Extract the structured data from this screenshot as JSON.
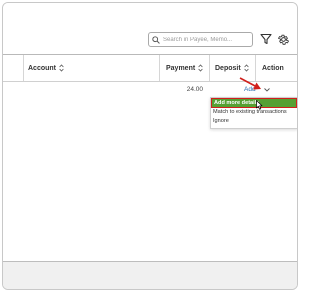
{
  "search": {
    "placeholder": "Search in Payee, Memo..."
  },
  "icons": {
    "search": "search-icon",
    "filter": "filter-icon",
    "settings": "gear-icon",
    "sort": "sort-icon",
    "chevron": "chevron-down-icon",
    "annotation_arrow": "red-arrow-icon",
    "cursor": "mouse-pointer-icon"
  },
  "table": {
    "columns": [
      {
        "label": "Account",
        "sortable": true
      },
      {
        "label": "Payment",
        "sortable": true
      },
      {
        "label": "Deposit",
        "sortable": true
      },
      {
        "label": "Action",
        "sortable": false
      }
    ],
    "rows": [
      {
        "payment": "24.00",
        "deposit": "",
        "action_label": "Add"
      }
    ]
  },
  "action_menu": {
    "items": [
      {
        "label": "Add more details",
        "highlighted": true
      },
      {
        "label": "Match to existing transactions",
        "highlighted": false
      },
      {
        "label": "Ignore",
        "highlighted": false
      }
    ]
  },
  "colors": {
    "link": "#2b6cb0",
    "highlight_bg": "#55a033",
    "annotation_red": "#d0201c"
  }
}
